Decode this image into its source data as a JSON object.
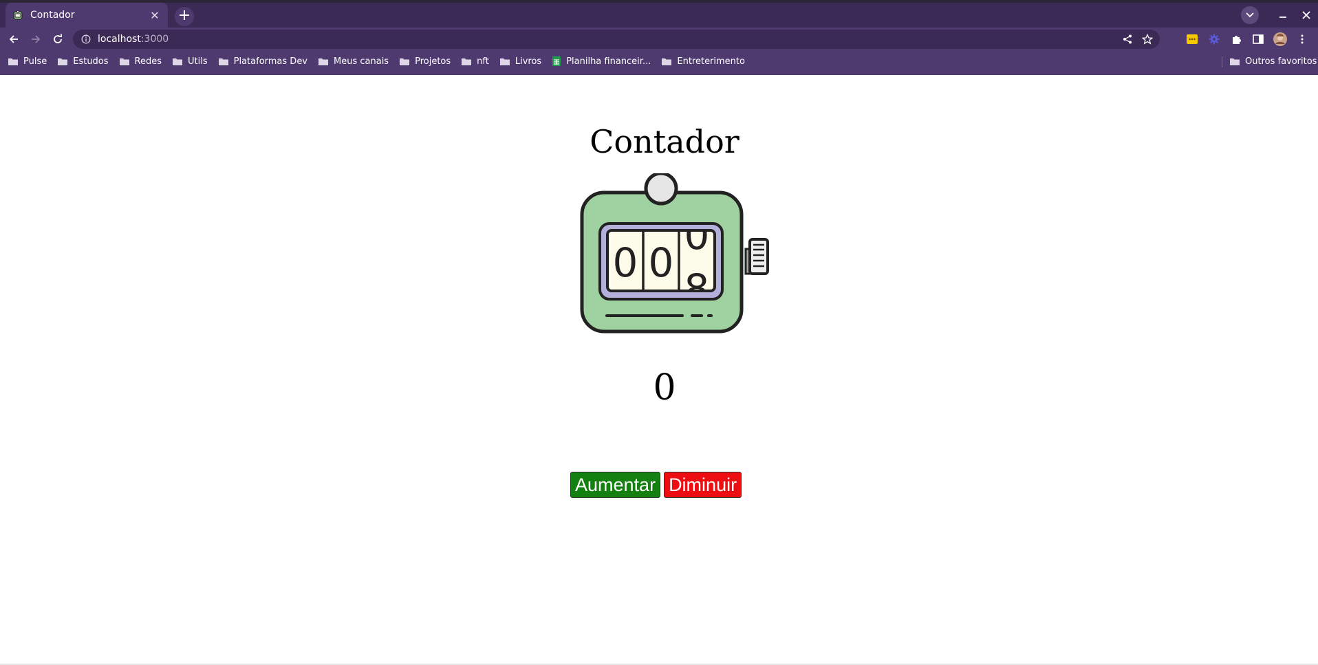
{
  "browser": {
    "tab_title": "Contador",
    "url_host": "localhost",
    "url_port": ":3000",
    "accent": "#4f3a70"
  },
  "bookmarks": [
    {
      "label": "Pulse",
      "icon": "folder-icon"
    },
    {
      "label": "Estudos",
      "icon": "folder-icon"
    },
    {
      "label": "Redes",
      "icon": "folder-icon"
    },
    {
      "label": "Utils",
      "icon": "folder-icon"
    },
    {
      "label": "Plataformas Dev",
      "icon": "folder-icon"
    },
    {
      "label": "Meus canais",
      "icon": "folder-icon"
    },
    {
      "label": "Projetos",
      "icon": "folder-icon"
    },
    {
      "label": "nft",
      "icon": "folder-icon"
    },
    {
      "label": "Livros",
      "icon": "folder-icon"
    },
    {
      "label": "Planilha financeir...",
      "icon": "sheets-icon"
    },
    {
      "label": "Entreterimento",
      "icon": "folder-icon"
    }
  ],
  "other_bookmarks": "Outros favoritos",
  "page": {
    "title": "Contador",
    "count": "0",
    "increase_label": "Aumentar",
    "decrease_label": "Diminuir",
    "illustration_digits": [
      "0",
      "0",
      "8"
    ],
    "colors": {
      "increase": "#148010",
      "decrease": "#ee0d10",
      "device_body": "#a0d1a0",
      "device_window": "#b4b0dc",
      "digit_panel": "#fdfbea"
    }
  }
}
